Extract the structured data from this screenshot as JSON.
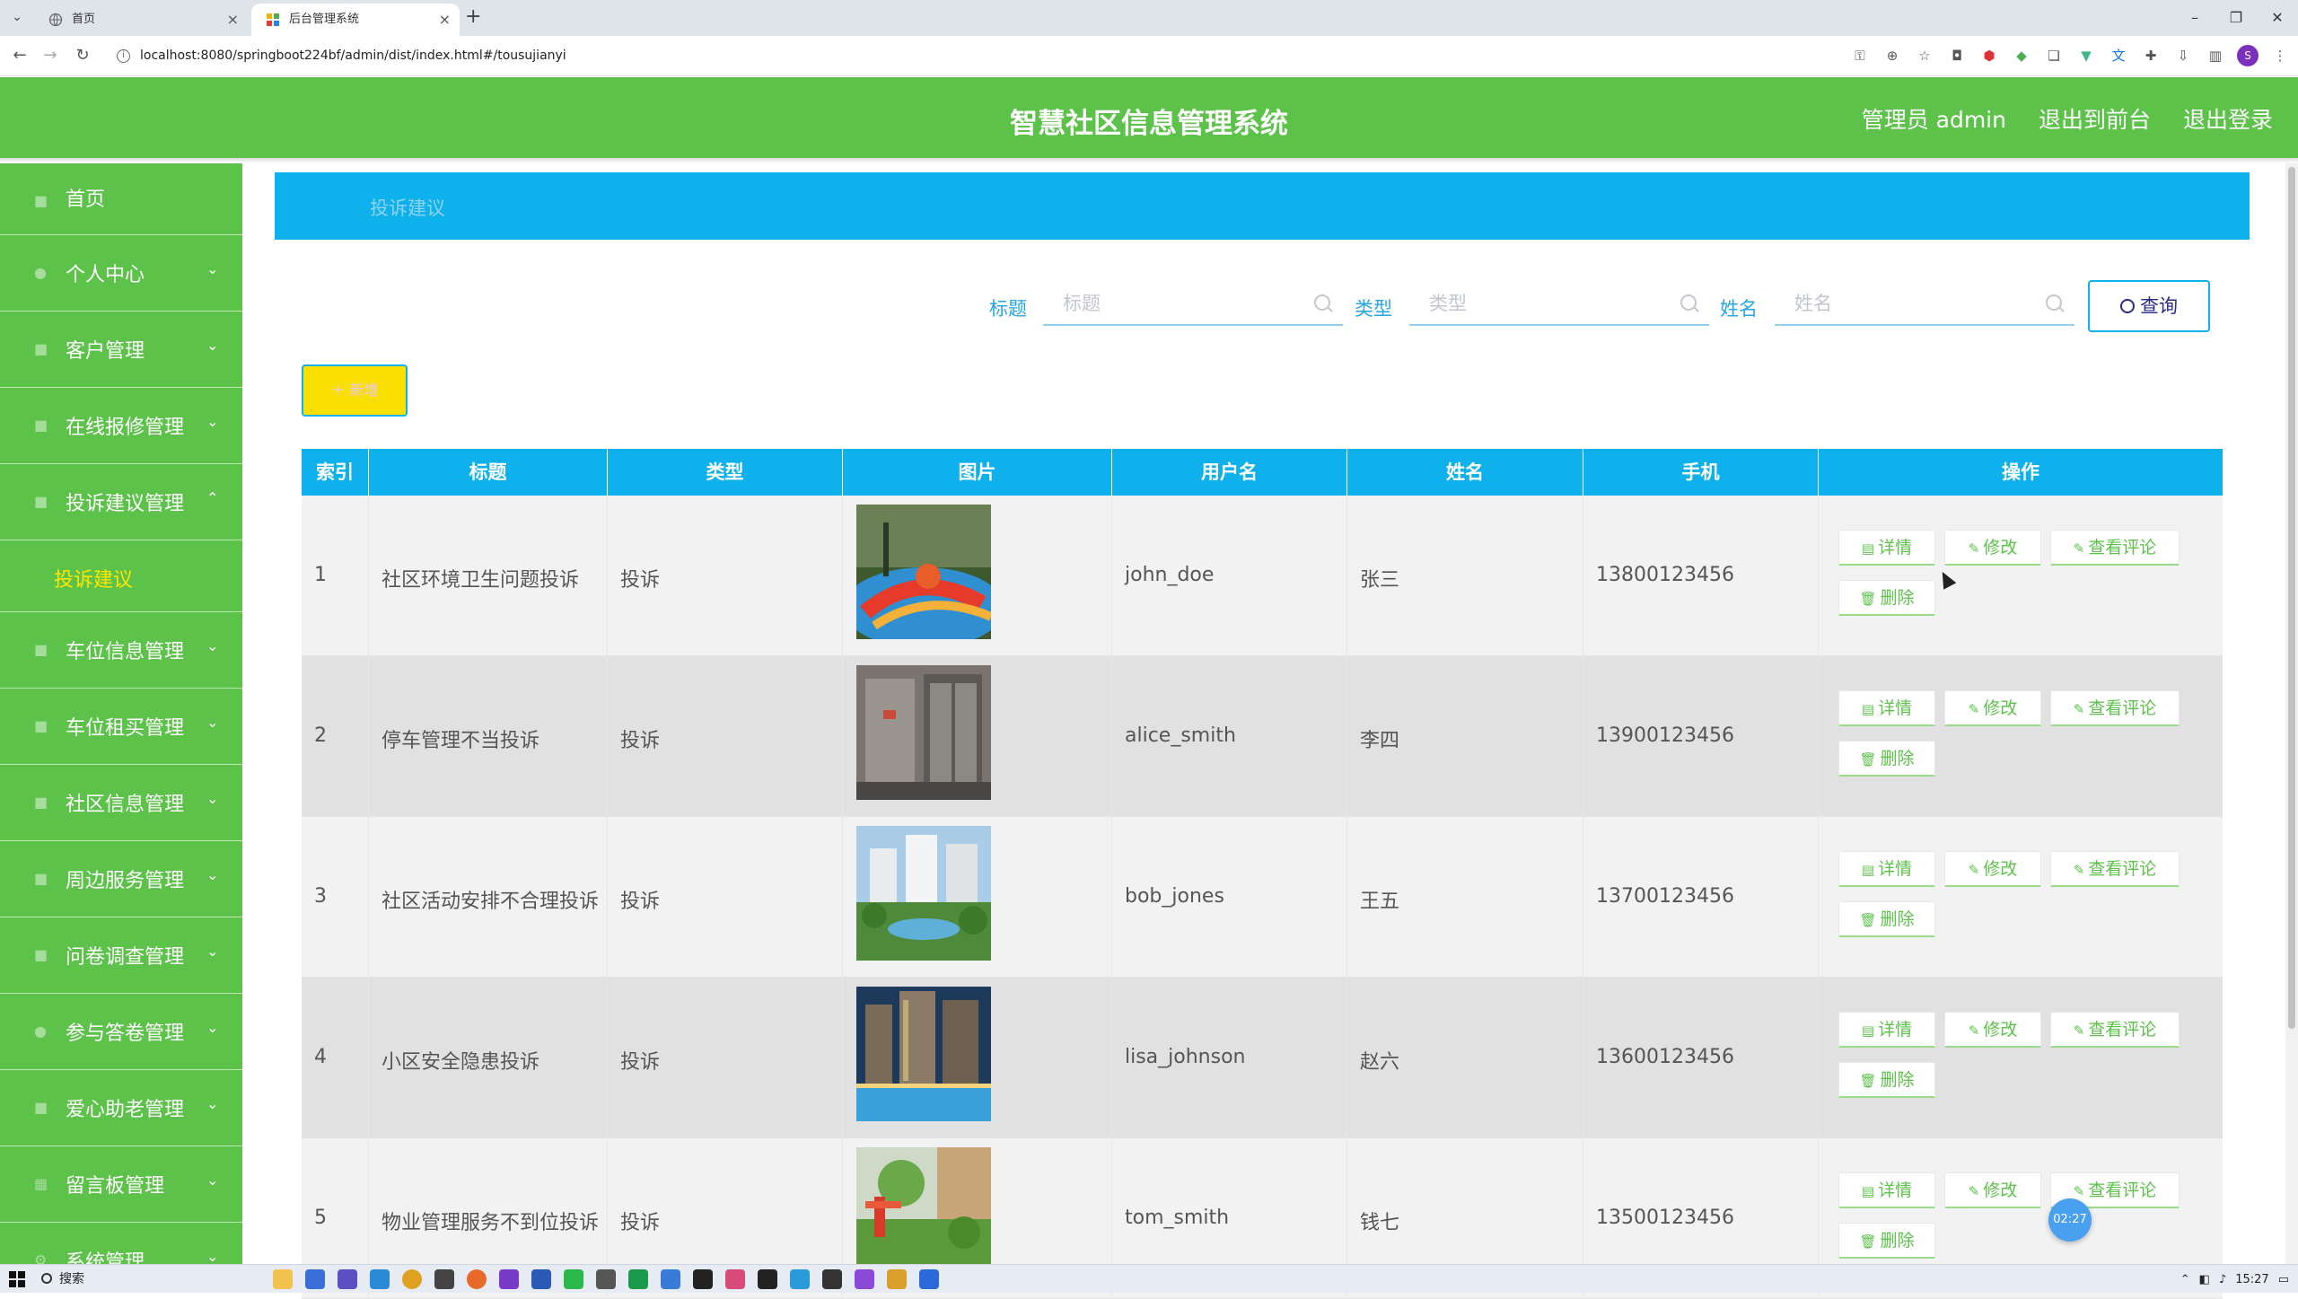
{
  "browser": {
    "tabs": [
      {
        "title": "首页",
        "active": false
      },
      {
        "title": "后台管理系统",
        "active": true
      }
    ],
    "url": "localhost:8080/springboot224bf/admin/dist/index.html#/tousujianyi"
  },
  "header": {
    "title": "智慧社区信息管理系统",
    "user_label": "管理员 admin",
    "back_to_front": "退出到前台",
    "logout": "退出登录"
  },
  "sidebar": {
    "items": [
      {
        "label": "首页",
        "expanded": false,
        "has_arrow": false
      },
      {
        "label": "个人中心",
        "has_arrow": true
      },
      {
        "label": "客户管理",
        "has_arrow": true
      },
      {
        "label": "在线报修管理",
        "has_arrow": true
      },
      {
        "label": "投诉建议管理",
        "has_arrow": true,
        "expanded": true
      },
      {
        "label": "车位信息管理",
        "has_arrow": true
      },
      {
        "label": "车位租买管理",
        "has_arrow": true
      },
      {
        "label": "社区信息管理",
        "has_arrow": true
      },
      {
        "label": "周边服务管理",
        "has_arrow": true
      },
      {
        "label": "问卷调查管理",
        "has_arrow": true
      },
      {
        "label": "参与答卷管理",
        "has_arrow": true
      },
      {
        "label": "爱心助老管理",
        "has_arrow": true
      },
      {
        "label": "留言板管理",
        "has_arrow": true
      },
      {
        "label": "系统管理",
        "has_arrow": true
      }
    ],
    "sub_item_active": "投诉建议"
  },
  "breadcrumb": "投诉建议",
  "search": {
    "title_label": "标题",
    "title_placeholder": "标题",
    "type_label": "类型",
    "type_placeholder": "类型",
    "name_label": "姓名",
    "name_placeholder": "姓名",
    "query_button": "查询"
  },
  "add_button": "新增",
  "table": {
    "columns": [
      "索引",
      "标题",
      "类型",
      "图片",
      "用户名",
      "姓名",
      "手机",
      "操作"
    ],
    "rows": [
      {
        "index": "1",
        "title": "社区环境卫生问题投诉",
        "type": "投诉",
        "image": "playground",
        "username": "john_doe",
        "name": "张三",
        "phone": "13800123456"
      },
      {
        "index": "2",
        "title": "停车管理不当投诉",
        "type": "投诉",
        "image": "elevator",
        "username": "alice_smith",
        "name": "李四",
        "phone": "13900123456"
      },
      {
        "index": "3",
        "title": "社区活动安排不合理投诉",
        "type": "投诉",
        "image": "garden",
        "username": "bob_jones",
        "name": "王五",
        "phone": "13700123456"
      },
      {
        "index": "4",
        "title": "小区安全隐患投诉",
        "type": "投诉",
        "image": "night-pool",
        "username": "lisa_johnson",
        "name": "赵六",
        "phone": "13600123456"
      },
      {
        "index": "5",
        "title": "物业管理服务不到位投诉",
        "type": "投诉",
        "image": "park",
        "username": "tom_smith",
        "name": "钱七",
        "phone": "13500123456"
      }
    ],
    "actions": {
      "detail": "详情",
      "edit": "修改",
      "comments": "查看评论",
      "delete": "删除"
    }
  },
  "float_badge": "02:27",
  "taskbar": {
    "search_label": "搜索",
    "time": "15:27"
  },
  "colors": {
    "brand_green": "#5cc24a",
    "accent_blue": "#0eb1ec",
    "submenu_active": "#ffe600",
    "add_button": "#f9e000"
  }
}
